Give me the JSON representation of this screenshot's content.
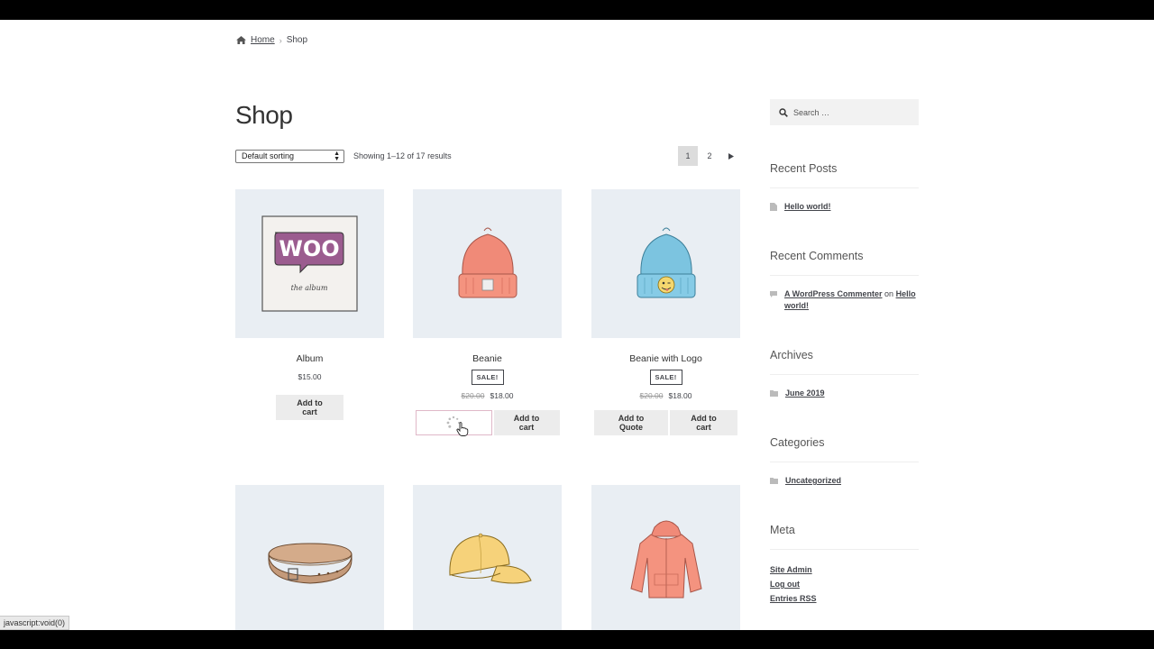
{
  "breadcrumb": {
    "home": "Home",
    "current": "Shop"
  },
  "page": {
    "title": "Shop"
  },
  "toolbar": {
    "sort_value": "Default sorting",
    "result_count": "Showing 1–12 of 17 results",
    "pages": [
      "1",
      "2"
    ],
    "next_icon": "triangle-right-icon"
  },
  "products": [
    {
      "name": "Album",
      "price": "$15.00",
      "button": "Add to cart"
    },
    {
      "name": "Beanie",
      "sale": "SALE!",
      "old_price": "$20.00",
      "price": "$18.00",
      "button": "Add to cart",
      "loading_button": "quote-loading"
    },
    {
      "name": "Beanie with Logo",
      "sale": "SALE!",
      "old_price": "$20.00",
      "price": "$18.00",
      "quote_button": "Add to Quote",
      "button": "Add to cart"
    }
  ],
  "album_art": {
    "logo_text": "WOO",
    "caption": "the album"
  },
  "sidebar": {
    "search_placeholder": "Search …",
    "recent_posts": {
      "title": "Recent Posts",
      "items": [
        "Hello world!"
      ]
    },
    "recent_comments": {
      "title": "Recent Comments",
      "author": "A WordPress Commenter",
      "on": "on",
      "post": "Hello world!"
    },
    "archives": {
      "title": "Archives",
      "items": [
        "June 2019"
      ]
    },
    "categories": {
      "title": "Categories",
      "items": [
        "Uncategorized"
      ]
    },
    "meta": {
      "title": "Meta",
      "items": [
        "Site Admin",
        "Log out",
        "Entries RSS"
      ]
    }
  },
  "status_bar": "javascript:void(0)",
  "colors": {
    "accent_pink": "#e0b8c8",
    "thumb_bg": "#e9eef3"
  }
}
